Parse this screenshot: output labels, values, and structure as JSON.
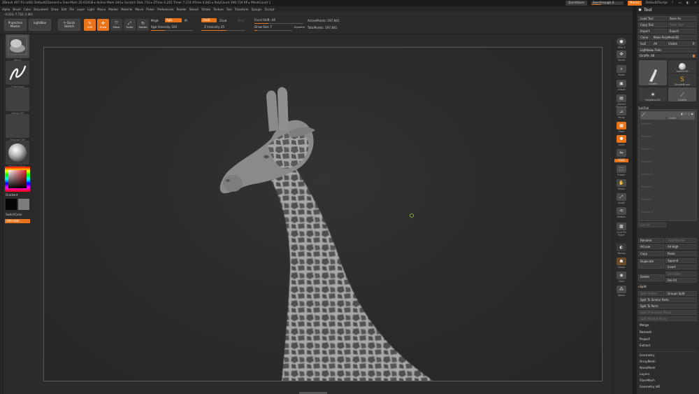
{
  "titlebar": {
    "text": "ZBrush 4R7 P3 (x64)   DefaultZGamer4   ▸ Free Mem 35.632GB ▸ Active Mem 344 ▸ Scratch Disk 731 ▸   ZTime 4.225  Timer 7.274  ATime 4.062 ▸ PolyCount 396.734 KP ▸ MeshCount 1",
    "quicksave": "QuickSave",
    "see_through": "See-through",
    "see_through_value": "0",
    "menus_btn": "Menus",
    "script": "DefaultZScript"
  },
  "menubar": [
    "Alpha",
    "Brush",
    "Color",
    "Document",
    "Draw",
    "Edit",
    "File",
    "Layer",
    "Light",
    "Macro",
    "Marker",
    "Material",
    "Movie",
    "Picker",
    "Preferences",
    "Render",
    "Stencil",
    "Stroke",
    "Texture",
    "Tool",
    "Transform",
    "Zplugin",
    "Zscript"
  ],
  "shelf": {
    "coords": "-0.014,-7.732,-1.061",
    "projection_master": "Projection Master",
    "lightbox": "LightBox",
    "quick_sketch": "Quick Sketch",
    "edit": "Edit",
    "draw": "Draw",
    "move": "Move",
    "scale": "Scale",
    "rotate": "Rotate",
    "mrgb": "Mrgb",
    "rgb": "Rgb",
    "m": "M",
    "rgb_intensity": "Rgb Intensity 100",
    "zadd": "Zadd",
    "zsub": "Zsub",
    "zcut": "Zcut",
    "z_intensity": "Z Intensity 25",
    "focal_shift": "Focal Shift -44",
    "draw_size": "Draw Size 7",
    "dynamic": "Dynamic",
    "active_points": "ActivePoints: 197,841",
    "total_points": "TotalPoints: 197,841"
  },
  "left": {
    "brush_label": "Move",
    "stroke_label": "Freehand",
    "alpha_label": "Alpha Off",
    "texture_label": "Texture Off",
    "material_label": "MatCap Gray",
    "gradient": "Gradient",
    "switch_color": "SwitchColor",
    "alternate": "Alternate"
  },
  "right_shelf": {
    "spix": "SPix 3",
    "scroll": "Scroll",
    "zoom": "Zoom",
    "actual": "Actual",
    "aahalf": "AAHalf",
    "dynamic": "Dynamic",
    "persp": "Persp",
    "floor": "Floor",
    "local": "Local",
    "lsym": "L.Sym",
    "xyz": "Gxyz",
    "frame": "Frame",
    "move": "Move",
    "scale": "Scale",
    "rotate": "Rotate",
    "linefill": "Line Fill",
    "polyf": "PolyF",
    "transp": "Transp",
    "ghost": "Ghost",
    "solo": "Solo",
    "xpose": "Xpose"
  },
  "tool_panel": {
    "title": "Tool",
    "load_tool": "Load Tool",
    "save_as": "Save As",
    "copy_tool": "Copy Tool",
    "paste_tool": "Paste Tool",
    "import": "Import",
    "export": "Export",
    "clone": "Clone",
    "make_polymesh": "Make PolyMesh3D",
    "goz": "GoZ",
    "all": "All",
    "visible": "Visible",
    "r": "R",
    "lightbox_tools": "Lightbox▸ Tools",
    "giraffe_slider": "Giraffe. 48",
    "tools": [
      {
        "label": "Giraffe"
      },
      {
        "label": "Sphere3D"
      },
      {
        "label": "SimpleBrush"
      },
      {
        "label": "PolyMesh3D"
      },
      {
        "label": "Giraffe"
      }
    ],
    "subtool": "SubTool",
    "subtool_item": "Giraffe",
    "subtool_empty": [
      "Subtool 1",
      "Subtool 2",
      "Subtool 3",
      "Subtool 4",
      "Subtool 5",
      "Subtool 6",
      "Subtool 7",
      "Subtool 8"
    ],
    "list_all": "List All",
    "rename": "Rename",
    "autoreorder": "AutoReorder",
    "all_low": "All Low",
    "all_high": "All High",
    "copy": "Copy",
    "paste": "Paste",
    "duplicate": "Duplicate",
    "append": "Append",
    "insert": "Insert",
    "del_other": "Del Other",
    "delete": "Delete",
    "del_all": "Del All",
    "split": "Split",
    "split_hidden": "Split Hidden",
    "groups_split": "Groups Split",
    "split_similar": "Split To Similar Parts",
    "split_parts": "Split To Parts",
    "split_unmasked": "Split Unmasked Points",
    "split_masked": "Split Masked Points",
    "merge": "Merge",
    "remesh": "Remesh",
    "project": "Project",
    "extract": "Extract",
    "sections": [
      "Geometry",
      "ArrayMesh",
      "NanoMesh",
      "Layers",
      "FiberMesh",
      "Geometry HD"
    ]
  },
  "colors": {
    "accent": "#e8741b",
    "background": "#2a2a2a"
  }
}
